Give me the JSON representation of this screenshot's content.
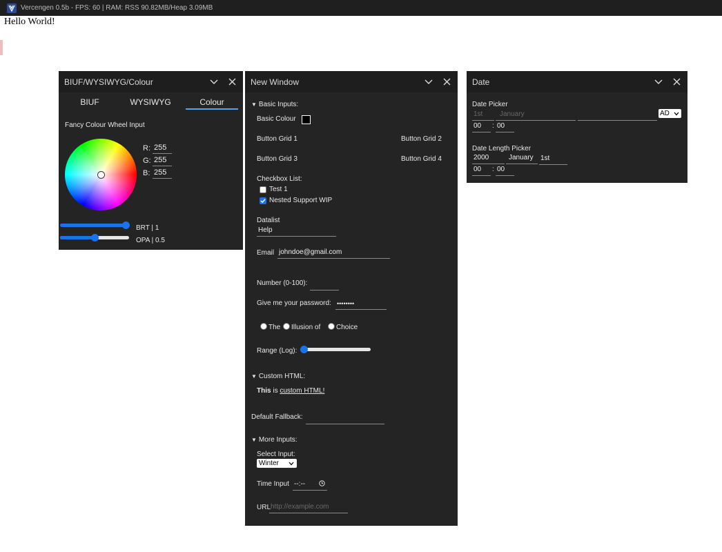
{
  "app": {
    "title": "Vercengen 0.5b - FPS: 60 | RAM: RSS 90.82MB/Heap 3.09MB"
  },
  "page": {
    "hello": "Hello World!"
  },
  "colour_window": {
    "title": "BIUF/WYSIWYG/Colour",
    "tabs": [
      "BIUF",
      "WYSIWYG",
      "Colour"
    ],
    "active_tab": "Colour",
    "wheel_label": "Fancy Colour Wheel Input",
    "r_label": "R:",
    "r_value": "255",
    "g_label": "G:",
    "g_value": "255",
    "b_label": "B:",
    "b_value": "255",
    "brt_label": "BRT | 1",
    "brt_value": 1,
    "opa_label": "OPA | 0.5",
    "opa_value": 0.5,
    "accent": "#1a73e8"
  },
  "new_window": {
    "title": "New Window",
    "basic_inputs_label": "Basic Inputs:",
    "basic_colour_label": "Basic Colour",
    "basic_colour_value": "#000000",
    "button_grid": [
      "Button Grid 1",
      "Button Grid 2",
      "Button Grid 3",
      "Button Grid 4"
    ],
    "checkbox_list_label": "Checkbox List:",
    "checkboxes": [
      {
        "label": "Test 1",
        "checked": false
      },
      {
        "label": "Nested Support WIP",
        "checked": true
      }
    ],
    "datalist_label": "Datalist",
    "datalist_value": "Help",
    "email_label": "Email",
    "email_value": "johndoe@gmail.com",
    "number_label": "Number (0-100):",
    "password_label": "Give me your password:",
    "password_value": "••••••••",
    "radios": [
      "The",
      "Illusion of",
      "Choice"
    ],
    "range_label": "Range (Log):",
    "range_value": 0,
    "custom_html_label": "Custom HTML:",
    "custom_html_bold": "This",
    "custom_html_mid": " is ",
    "custom_html_link": "custom HTML!",
    "default_fallback_label": "Default Fallback:",
    "more_inputs_label": "More Inputs:",
    "select_label": "Select Input:",
    "select_value": "Winter",
    "time_label": "Time Input",
    "time_value": "--:--",
    "url_label": "URL",
    "url_placeholder": "http://example.com"
  },
  "date_window": {
    "title": "Date",
    "date_picker_label": "Date Picker",
    "day_placeholder": "1st",
    "month_placeholder": "January",
    "era_value": "AD",
    "hour1": "00",
    "minute1": "00",
    "length_label": "Date Length Picker",
    "year_value": "2000",
    "month_value": "January",
    "day_value": "1st",
    "hour2": "00",
    "minute2": "00",
    "time_sep": ":"
  }
}
